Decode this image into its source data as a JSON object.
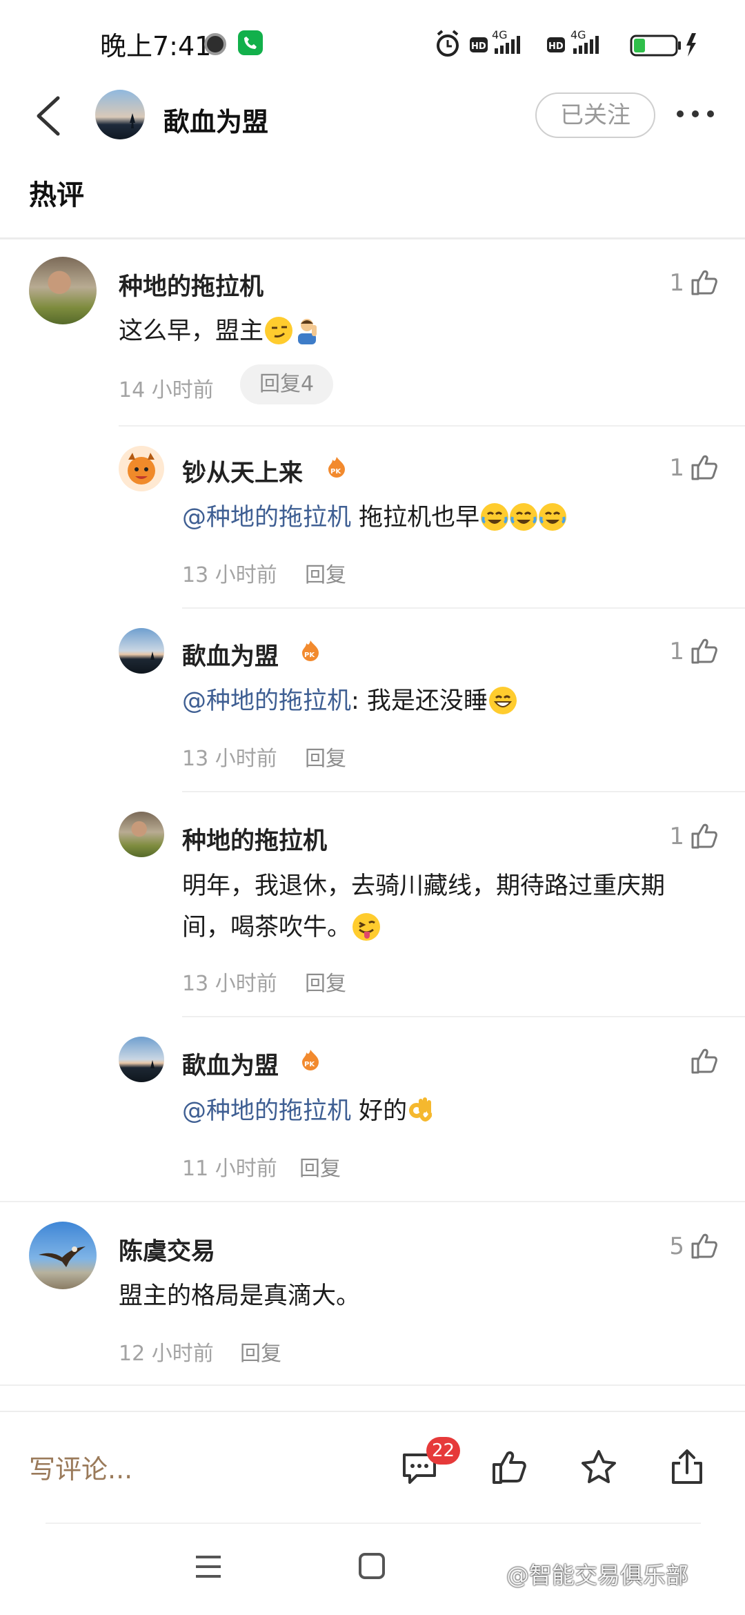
{
  "status_bar": {
    "time": "晚上7:41",
    "network_1": "4G",
    "network_2": "4G",
    "battery": "26"
  },
  "header": {
    "title": "歃血为盟",
    "follow_label": "已关注"
  },
  "section_title": "热评",
  "comments": [
    {
      "name": "种地的拖拉机",
      "text": "这么早，盟主",
      "time": "14 小时前",
      "reply_label": "回复4",
      "likes": "1",
      "replies": [
        {
          "name": "钞从天上来",
          "mention": "@种地的拖拉机",
          "text": " 拖拉机也早",
          "time": "13 小时前",
          "reply_label": "回复",
          "likes": "1"
        },
        {
          "name": "歃血为盟",
          "mention": "@种地的拖拉机",
          "text": ": 我是还没睡",
          "time": "13 小时前",
          "reply_label": "回复",
          "likes": "1"
        },
        {
          "name": "种地的拖拉机",
          "text_line1": "明年，我退休，去骑川藏线，期待路过重庆期",
          "text_line2": "间，喝茶吹牛。",
          "time": "13 小时前",
          "reply_label": "回复",
          "likes": "1"
        },
        {
          "name": "歃血为盟",
          "mention": "@种地的拖拉机",
          "text": " 好的",
          "time": "11 小时前",
          "reply_label": "回复",
          "likes": ""
        }
      ]
    },
    {
      "name": "陈虞交易",
      "text": "盟主的格局是真滴大。",
      "time": "12 小时前",
      "reply_label": "回复",
      "likes": "5"
    }
  ],
  "bottom_bar": {
    "write_placeholder": "写评论...",
    "comment_count": "22"
  },
  "watermark": "@智能交易俱乐部"
}
